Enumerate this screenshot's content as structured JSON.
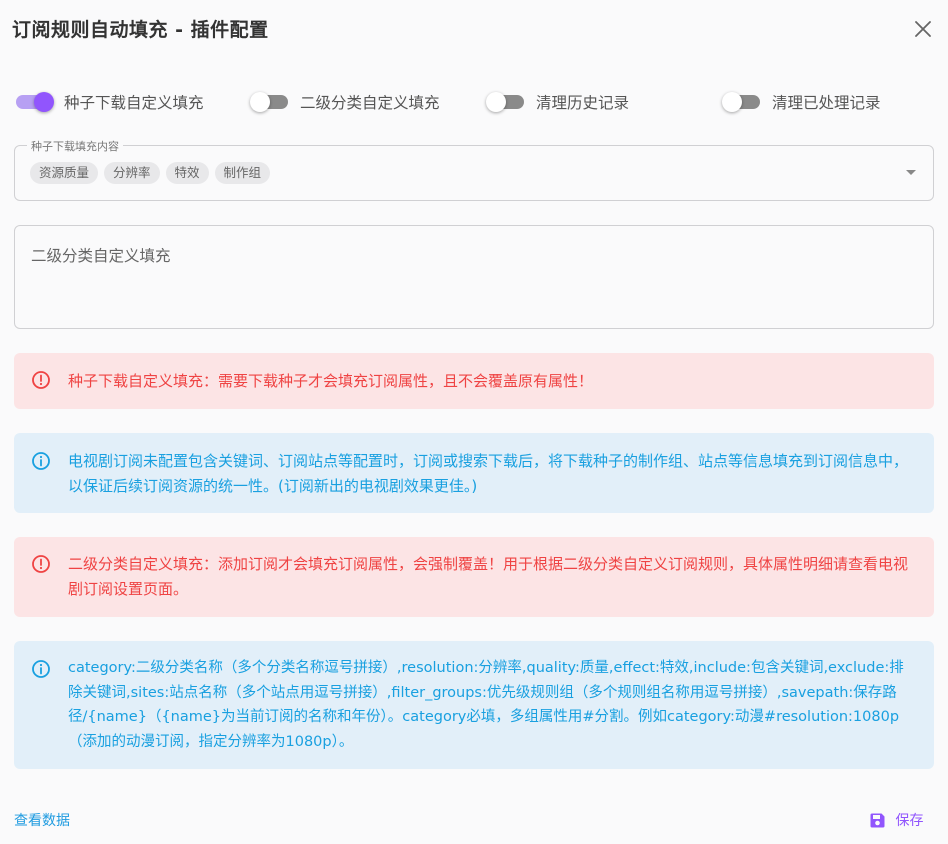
{
  "dialog": {
    "title": "订阅规则自动填充 - 插件配置"
  },
  "switches": [
    {
      "label": "种子下载自定义填充",
      "on": true
    },
    {
      "label": "二级分类自定义填充",
      "on": false
    },
    {
      "label": "清理历史记录",
      "on": false
    },
    {
      "label": "清理已处理记录",
      "on": false
    }
  ],
  "torrent_select": {
    "legend": "种子下载填充内容",
    "chips": [
      "资源质量",
      "分辨率",
      "特效",
      "制作组"
    ]
  },
  "category_textarea": {
    "placeholder": "二级分类自定义填充"
  },
  "alerts": [
    {
      "type": "error",
      "text": "种子下载自定义填充：需要下载种子才会填充订阅属性，且不会覆盖原有属性！"
    },
    {
      "type": "info",
      "text": "电视剧订阅未配置包含关键词、订阅站点等配置时，订阅或搜索下载后，将下载种子的制作组、站点等信息填充到订阅信息中，以保证后续订阅资源的统一性。(订阅新出的电视剧效果更佳。)"
    },
    {
      "type": "error",
      "text": "二级分类自定义填充：添加订阅才会填充订阅属性，会强制覆盖！用于根据二级分类自定义订阅规则，具体属性明细请查看电视剧订阅设置页面。"
    },
    {
      "type": "info",
      "text": "category:二级分类名称（多个分类名称逗号拼接）,resolution:分辨率,quality:质量,effect:特效,include:包含关键词,exclude:排除关键词,sites:站点名称（多个站点用逗号拼接）,filter_groups:优先级规则组（多个规则组名称用逗号拼接）,savepath:保存路径/{name}（{name}为当前订阅的名称和年份）。category必填，多组属性用#分割。例如category:动漫#resolution:1080p（添加的动漫订阅，指定分辨率为1080p）。"
    }
  ],
  "footer": {
    "view_data_label": "查看数据",
    "save_label": "保存"
  },
  "colors": {
    "accent": "#9155fd",
    "error_bg": "#fce4e5",
    "error_text": "#ef4343",
    "info_bg": "#e2eff9",
    "info_text": "#19a0e0",
    "link": "#1f9be0"
  },
  "icons": {
    "close": "close-icon",
    "error": "alert-circle-icon",
    "info": "info-circle-icon",
    "save": "floppy-disk-icon",
    "dropdown": "caret-down-icon"
  }
}
